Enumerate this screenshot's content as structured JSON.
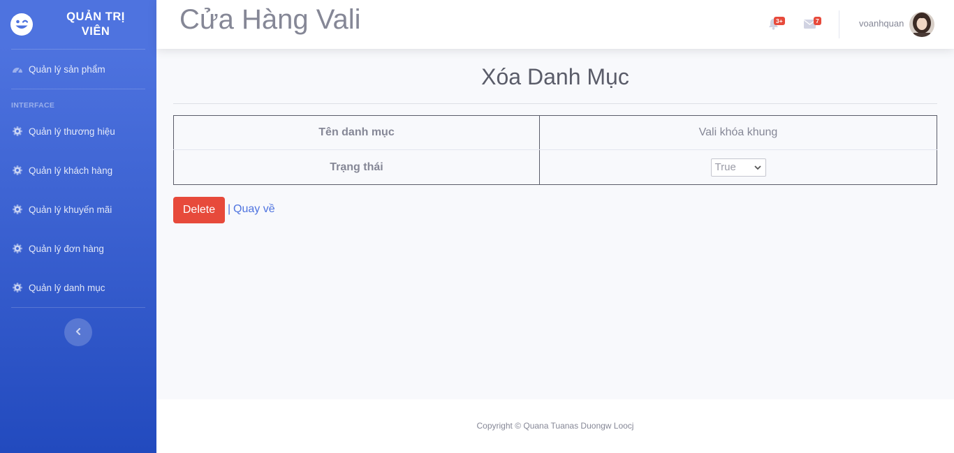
{
  "sidebar": {
    "brand_line1": "QUẢN TRỊ",
    "brand_line2": "VIÊN",
    "brand_icon": "laugh-wink-icon",
    "dashboard_item": {
      "label": "Quản lý sản phẩm",
      "icon": "tachometer-icon"
    },
    "heading": "INTERFACE",
    "items": [
      {
        "label": "Quản lý thương hiệu",
        "icon": "cog-icon"
      },
      {
        "label": "Quản lý khách hàng",
        "icon": "cog-icon"
      },
      {
        "label": "Quản lý khuyến mãi",
        "icon": "cog-icon"
      },
      {
        "label": "Quản lý đơn hàng",
        "icon": "cog-icon"
      },
      {
        "label": "Quản lý danh mục",
        "icon": "cog-icon"
      }
    ],
    "toggle_icon": "chevron-left-icon"
  },
  "topbar": {
    "title": "Cửa Hàng Vali",
    "alerts_badge": "3+",
    "messages_badge": "7",
    "username": "voanhquan"
  },
  "main": {
    "heading": "Xóa Danh Mục",
    "rows": [
      {
        "label": "Tên danh mục",
        "value": "Vali khóa khung"
      },
      {
        "label": "Trạng thái",
        "value": "True"
      }
    ],
    "delete_label": "Delete",
    "separator": "|",
    "back_label": "Quay về"
  },
  "footer": {
    "copyright": "Copyright © Quana Tuanas Duongw Loocj"
  },
  "colors": {
    "primary": "#4e73df",
    "danger": "#e74a3b",
    "text": "#858796"
  }
}
